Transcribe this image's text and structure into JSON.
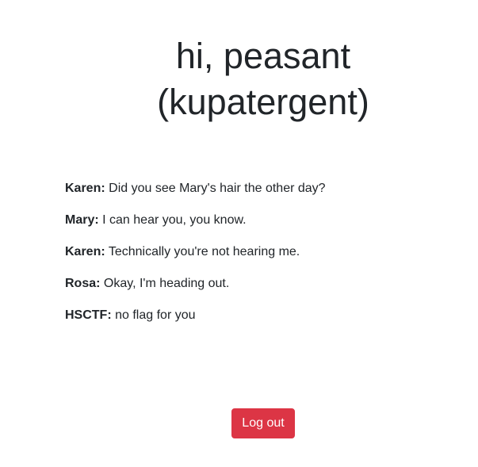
{
  "header": {
    "line1": "hi, peasant",
    "line2": "(kupatergent)"
  },
  "messages": [
    {
      "speaker": "Karen:",
      "text": "Did you see Mary's hair the other day?"
    },
    {
      "speaker": "Mary:",
      "text": "I can hear you, you know."
    },
    {
      "speaker": "Karen:",
      "text": "Technically you're not hearing me."
    },
    {
      "speaker": "Rosa:",
      "text": "Okay, I'm heading out."
    },
    {
      "speaker": "HSCTF:",
      "text": "no flag for you"
    }
  ],
  "actions": {
    "logout_label": "Log out",
    "logout_color": "#dc3545"
  }
}
